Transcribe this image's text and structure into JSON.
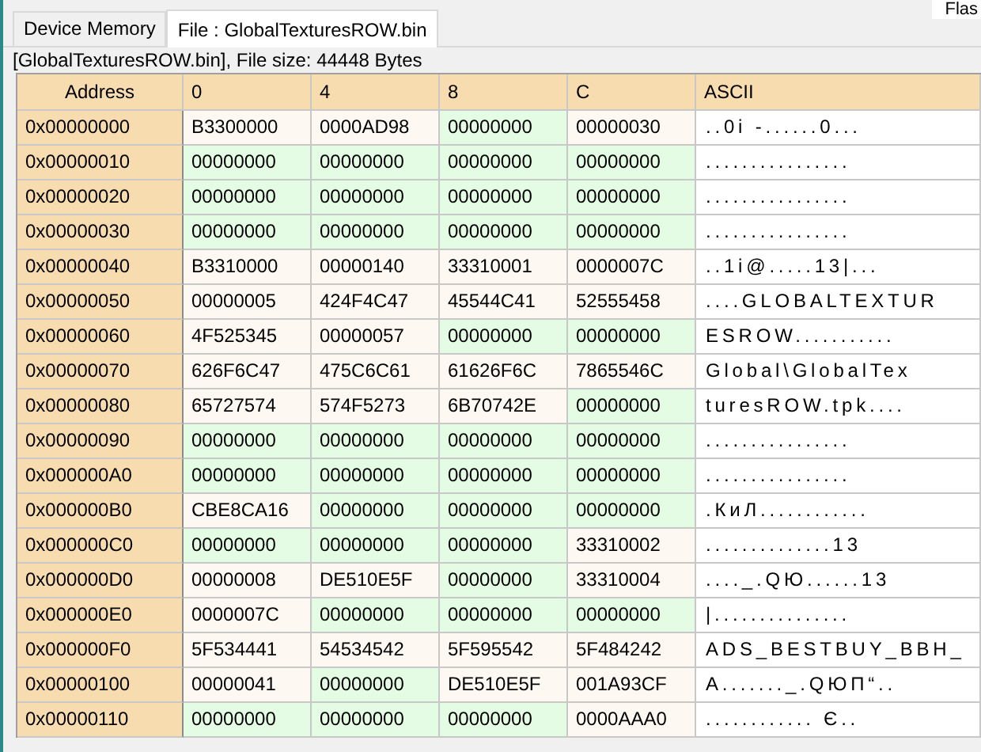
{
  "corner_label": "Flas",
  "tabs": [
    {
      "label": "Device Memory",
      "selected": false
    },
    {
      "label": "File : GlobalTexturesROW.bin",
      "selected": true
    }
  ],
  "file_info": "[GlobalTexturesROW.bin], File size: 44448 Bytes",
  "table": {
    "columns": [
      "Address",
      "0",
      "4",
      "8",
      "C",
      "ASCII"
    ],
    "rows": [
      {
        "cells": [
          {
            "kind": "address",
            "value": "0x00000000"
          },
          {
            "kind": "hex",
            "value": "B3300000",
            "zero": false
          },
          {
            "kind": "hex",
            "value": "0000AD98",
            "zero": false
          },
          {
            "kind": "hex",
            "value": "00000000",
            "zero": true
          },
          {
            "kind": "hex",
            "value": "00000030",
            "zero": false
          },
          {
            "kind": "ascii",
            "value": "..0i -......0..."
          }
        ]
      },
      {
        "cells": [
          {
            "kind": "address",
            "value": "0x00000010"
          },
          {
            "kind": "hex",
            "value": "00000000",
            "zero": true
          },
          {
            "kind": "hex",
            "value": "00000000",
            "zero": true
          },
          {
            "kind": "hex",
            "value": "00000000",
            "zero": true
          },
          {
            "kind": "hex",
            "value": "00000000",
            "zero": true
          },
          {
            "kind": "ascii",
            "value": "................"
          }
        ]
      },
      {
        "cells": [
          {
            "kind": "address",
            "value": "0x00000020"
          },
          {
            "kind": "hex",
            "value": "00000000",
            "zero": true
          },
          {
            "kind": "hex",
            "value": "00000000",
            "zero": true
          },
          {
            "kind": "hex",
            "value": "00000000",
            "zero": true
          },
          {
            "kind": "hex",
            "value": "00000000",
            "zero": true
          },
          {
            "kind": "ascii",
            "value": "................"
          }
        ]
      },
      {
        "cells": [
          {
            "kind": "address",
            "value": "0x00000030"
          },
          {
            "kind": "hex",
            "value": "00000000",
            "zero": true
          },
          {
            "kind": "hex",
            "value": "00000000",
            "zero": true
          },
          {
            "kind": "hex",
            "value": "00000000",
            "zero": true
          },
          {
            "kind": "hex",
            "value": "00000000",
            "zero": true
          },
          {
            "kind": "ascii",
            "value": "................"
          }
        ]
      },
      {
        "cells": [
          {
            "kind": "address",
            "value": "0x00000040"
          },
          {
            "kind": "hex",
            "value": "B3310000",
            "zero": false
          },
          {
            "kind": "hex",
            "value": "00000140",
            "zero": false
          },
          {
            "kind": "hex",
            "value": "33310001",
            "zero": false
          },
          {
            "kind": "hex",
            "value": "0000007C",
            "zero": false
          },
          {
            "kind": "ascii",
            "value": "..1i@.....13|..."
          }
        ]
      },
      {
        "cells": [
          {
            "kind": "address",
            "value": "0x00000050"
          },
          {
            "kind": "hex",
            "value": "00000005",
            "zero": false
          },
          {
            "kind": "hex",
            "value": "424F4C47",
            "zero": false
          },
          {
            "kind": "hex",
            "value": "45544C41",
            "zero": false
          },
          {
            "kind": "hex",
            "value": "52555458",
            "zero": false
          },
          {
            "kind": "ascii",
            "value": "....GLOBALTEXTUR"
          }
        ]
      },
      {
        "cells": [
          {
            "kind": "address",
            "value": "0x00000060"
          },
          {
            "kind": "hex",
            "value": "4F525345",
            "zero": false
          },
          {
            "kind": "hex",
            "value": "00000057",
            "zero": false
          },
          {
            "kind": "hex",
            "value": "00000000",
            "zero": true
          },
          {
            "kind": "hex",
            "value": "00000000",
            "zero": true
          },
          {
            "kind": "ascii",
            "value": "ESROW..........."
          }
        ]
      },
      {
        "cells": [
          {
            "kind": "address",
            "value": "0x00000070"
          },
          {
            "kind": "hex",
            "value": "626F6C47",
            "zero": false
          },
          {
            "kind": "hex",
            "value": "475C6C61",
            "zero": false
          },
          {
            "kind": "hex",
            "value": "61626F6C",
            "zero": false
          },
          {
            "kind": "hex",
            "value": "7865546C",
            "zero": false
          },
          {
            "kind": "ascii",
            "value": "Global\\GlobalTex"
          }
        ]
      },
      {
        "cells": [
          {
            "kind": "address",
            "value": "0x00000080"
          },
          {
            "kind": "hex",
            "value": "65727574",
            "zero": false
          },
          {
            "kind": "hex",
            "value": "574F5273",
            "zero": false
          },
          {
            "kind": "hex",
            "value": "6B70742E",
            "zero": false
          },
          {
            "kind": "hex",
            "value": "00000000",
            "zero": true
          },
          {
            "kind": "ascii",
            "value": "turesROW.tpk...."
          }
        ]
      },
      {
        "cells": [
          {
            "kind": "address",
            "value": "0x00000090"
          },
          {
            "kind": "hex",
            "value": "00000000",
            "zero": true
          },
          {
            "kind": "hex",
            "value": "00000000",
            "zero": true
          },
          {
            "kind": "hex",
            "value": "00000000",
            "zero": true
          },
          {
            "kind": "hex",
            "value": "00000000",
            "zero": true
          },
          {
            "kind": "ascii",
            "value": "................"
          }
        ]
      },
      {
        "cells": [
          {
            "kind": "address",
            "value": "0x000000A0"
          },
          {
            "kind": "hex",
            "value": "00000000",
            "zero": true
          },
          {
            "kind": "hex",
            "value": "00000000",
            "zero": true
          },
          {
            "kind": "hex",
            "value": "00000000",
            "zero": true
          },
          {
            "kind": "hex",
            "value": "00000000",
            "zero": true
          },
          {
            "kind": "ascii",
            "value": "................"
          }
        ]
      },
      {
        "cells": [
          {
            "kind": "address",
            "value": "0x000000B0"
          },
          {
            "kind": "hex",
            "value": "CBE8CA16",
            "zero": false
          },
          {
            "kind": "hex",
            "value": "00000000",
            "zero": true
          },
          {
            "kind": "hex",
            "value": "00000000",
            "zero": true
          },
          {
            "kind": "hex",
            "value": "00000000",
            "zero": true
          },
          {
            "kind": "ascii",
            "value": ".КиЛ............"
          }
        ]
      },
      {
        "cells": [
          {
            "kind": "address",
            "value": "0x000000C0"
          },
          {
            "kind": "hex",
            "value": "00000000",
            "zero": true
          },
          {
            "kind": "hex",
            "value": "00000000",
            "zero": true
          },
          {
            "kind": "hex",
            "value": "00000000",
            "zero": true
          },
          {
            "kind": "hex",
            "value": "33310002",
            "zero": false
          },
          {
            "kind": "ascii",
            "value": "..............13"
          }
        ]
      },
      {
        "cells": [
          {
            "kind": "address",
            "value": "0x000000D0"
          },
          {
            "kind": "hex",
            "value": "00000008",
            "zero": false
          },
          {
            "kind": "hex",
            "value": "DE510E5F",
            "zero": false
          },
          {
            "kind": "hex",
            "value": "00000000",
            "zero": true
          },
          {
            "kind": "hex",
            "value": "33310004",
            "zero": false
          },
          {
            "kind": "ascii",
            "value": "...._.QЮ......13"
          }
        ]
      },
      {
        "cells": [
          {
            "kind": "address",
            "value": "0x000000E0"
          },
          {
            "kind": "hex",
            "value": "0000007C",
            "zero": false
          },
          {
            "kind": "hex",
            "value": "00000000",
            "zero": true
          },
          {
            "kind": "hex",
            "value": "00000000",
            "zero": true
          },
          {
            "kind": "hex",
            "value": "00000000",
            "zero": true
          },
          {
            "kind": "ascii",
            "value": "|..............."
          }
        ]
      },
      {
        "cells": [
          {
            "kind": "address",
            "value": "0x000000F0"
          },
          {
            "kind": "hex",
            "value": "5F534441",
            "zero": false
          },
          {
            "kind": "hex",
            "value": "54534542",
            "zero": false
          },
          {
            "kind": "hex",
            "value": "5F595542",
            "zero": false
          },
          {
            "kind": "hex",
            "value": "5F484242",
            "zero": false
          },
          {
            "kind": "ascii",
            "value": "ADS_BESTBUY_BBH_"
          }
        ]
      },
      {
        "cells": [
          {
            "kind": "address",
            "value": "0x00000100"
          },
          {
            "kind": "hex",
            "value": "00000041",
            "zero": false
          },
          {
            "kind": "hex",
            "value": "00000000",
            "zero": true
          },
          {
            "kind": "hex",
            "value": "DE510E5F",
            "zero": false
          },
          {
            "kind": "hex",
            "value": "001A93CF",
            "zero": false
          },
          {
            "kind": "ascii",
            "value": "A......._.QЮП“.."
          }
        ]
      },
      {
        "cells": [
          {
            "kind": "address",
            "value": "0x00000110"
          },
          {
            "kind": "hex",
            "value": "00000000",
            "zero": true
          },
          {
            "kind": "hex",
            "value": "00000000",
            "zero": true
          },
          {
            "kind": "hex",
            "value": "00000000",
            "zero": true
          },
          {
            "kind": "hex",
            "value": "0000AAA0",
            "zero": false
          },
          {
            "kind": "ascii",
            "value": "............ Є.."
          }
        ]
      }
    ]
  }
}
